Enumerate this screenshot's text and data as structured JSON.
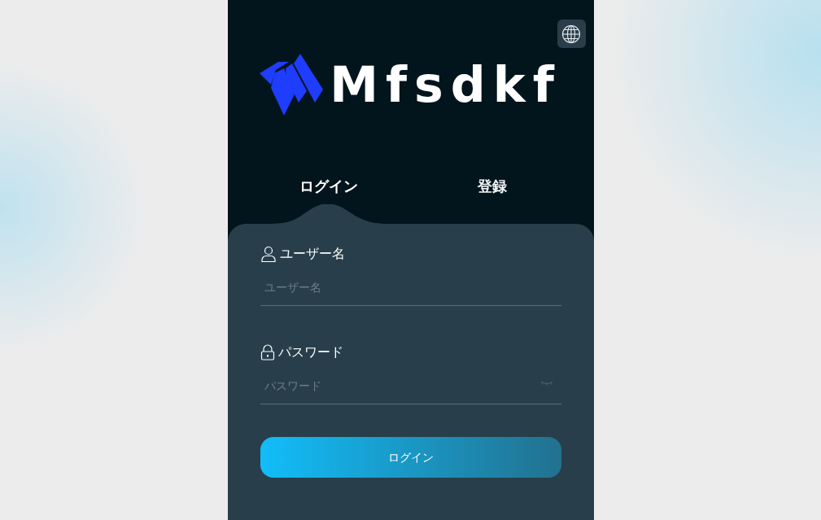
{
  "brand": {
    "name": "Mfsdkf"
  },
  "tabs": [
    {
      "label": "ログイン",
      "selected": true
    },
    {
      "label": "登録",
      "selected": false
    }
  ],
  "fields": [
    {
      "kind": "text",
      "label": "ユーザー名",
      "placeholder": "ユーザー名"
    },
    {
      "kind": "password",
      "label": "パスワード",
      "placeholder": "パスワード"
    }
  ],
  "submit": {
    "label": "ログイン"
  }
}
